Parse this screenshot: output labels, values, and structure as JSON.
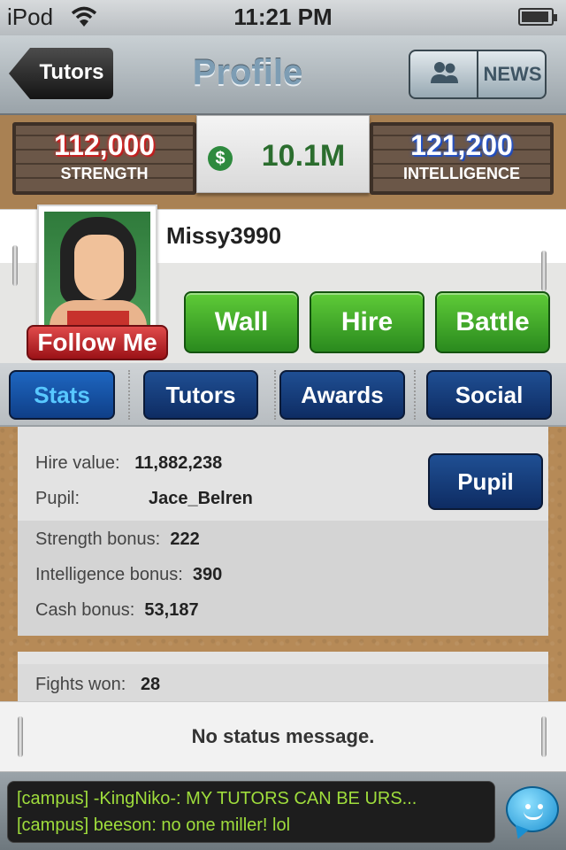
{
  "status_bar": {
    "carrier": "iPod",
    "time": "11:21 PM"
  },
  "nav": {
    "back_label": "Tutors",
    "title": "Profile",
    "news_label": "NEWS",
    "friends_icon": "people-icon"
  },
  "resources": {
    "strength": {
      "value": "112,000",
      "label": "STRENGTH"
    },
    "cash": {
      "value": "10.1M",
      "icon": "dollar-coin-icon"
    },
    "intelligence": {
      "value": "121,200",
      "label": "INTELLIGENCE"
    }
  },
  "profile": {
    "username": "Missy3990",
    "follow_label": "Follow Me",
    "actions": [
      "Wall",
      "Hire",
      "Battle"
    ]
  },
  "tabs": [
    {
      "label": "Stats",
      "active": true
    },
    {
      "label": "Tutors",
      "active": false
    },
    {
      "label": "Awards",
      "active": false
    },
    {
      "label": "Social",
      "active": false
    }
  ],
  "stats": {
    "hire_value_label": "Hire value:",
    "hire_value": "11,882,238",
    "pupil_label": "Pupil:",
    "pupil_value": "Jace_Belren",
    "pupil_button": "Pupil",
    "strength_bonus_label": "Strength bonus:",
    "strength_bonus": "222",
    "intelligence_bonus_label": "Intelligence bonus:",
    "intelligence_bonus": "390",
    "cash_bonus_label": "Cash bonus:",
    "cash_bonus": "53,187",
    "fights_won_label": "Fights won:",
    "fights_won": "28"
  },
  "status_message": "No status message.",
  "chat": {
    "lines": [
      "[campus] -KingNiko-: MY TUTORS CAN BE URS...",
      "[campus] beeson: no one miller! lol"
    ]
  },
  "colors": {
    "accent_blue": "#0e2c63",
    "action_green": "#2a8a1e",
    "follow_red": "#9b1217",
    "chat_green": "#9fdd3c"
  }
}
